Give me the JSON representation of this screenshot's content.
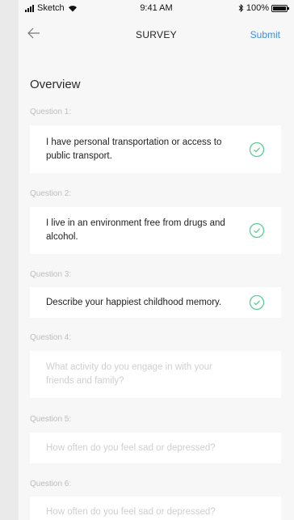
{
  "status_bar": {
    "carrier": "Sketch",
    "time": "9:41 AM",
    "battery": "100%"
  },
  "nav": {
    "title": "SURVEY",
    "submit_label": "Submit"
  },
  "section_title": "Overview",
  "questions": [
    {
      "label": "Question 1:",
      "text": "I have personal transportation or access to public transport.",
      "answered": true
    },
    {
      "label": "Question 2:",
      "text": "I live in an environment free from drugs and alcohol.",
      "answered": true
    },
    {
      "label": "Question 3:",
      "text": "Describe your happiest childhood memory.",
      "answered": true
    },
    {
      "label": "Question 4:",
      "placeholder": "What activity do you engage in with your friends and family?",
      "answered": false
    },
    {
      "label": "Question 5:",
      "placeholder": "How often do you feel sad or depressed?",
      "answered": false
    },
    {
      "label": "Question 6:",
      "placeholder": "How often do you feel sad or depressed?",
      "answered": false
    }
  ],
  "colors": {
    "accent": "#3a8fe6",
    "check": "#5ccf98",
    "placeholder": "#cfcfcf"
  }
}
